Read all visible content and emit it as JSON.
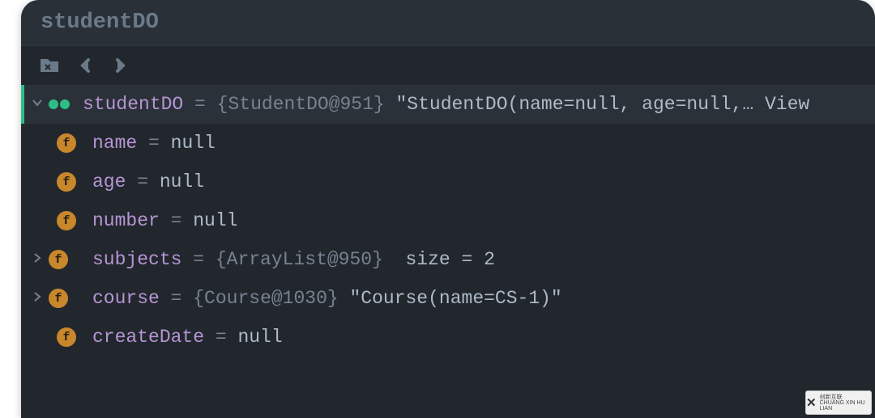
{
  "title": "studentDO",
  "root": {
    "name": "studentDO",
    "eq": " = ",
    "ref": "{StudentDO@951}",
    "repr": " \"StudentDO(name=null, age=null,… View"
  },
  "fields": [
    {
      "name": "name",
      "eq": " = ",
      "ref": "",
      "extra": "null"
    },
    {
      "name": "age",
      "eq": " = ",
      "ref": "",
      "extra": "null"
    },
    {
      "name": "number",
      "eq": " = ",
      "ref": "",
      "extra": "null"
    },
    {
      "name": "subjects",
      "eq": " = ",
      "ref": "{ArrayList@950} ",
      "extra": " size = 2"
    },
    {
      "name": "course",
      "eq": " = ",
      "ref": "{Course@1030}",
      "extra": " \"Course(name=CS-1)\""
    },
    {
      "name": "createDate",
      "eq": " = ",
      "ref": "",
      "extra": "null"
    }
  ],
  "watermark": {
    "zh": "创新互联",
    "py": "CHUANG XIN HU LIAN"
  }
}
